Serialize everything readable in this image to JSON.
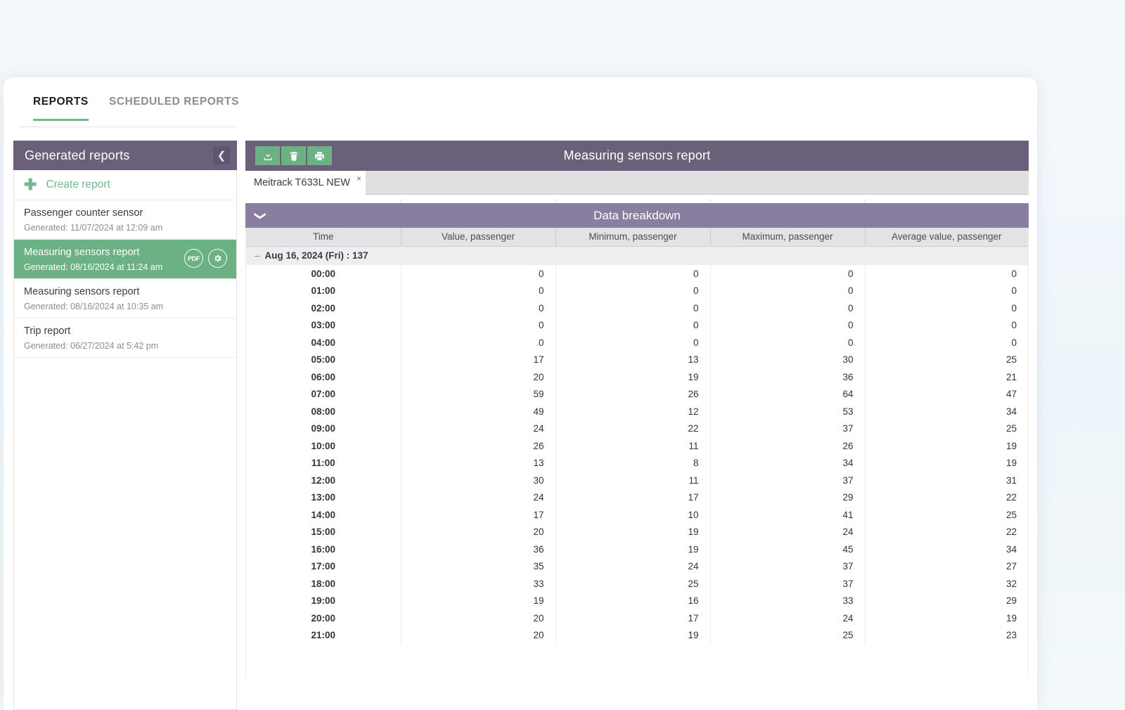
{
  "tabs": {
    "reports": "REPORTS",
    "scheduled": "SCHEDULED REPORTS"
  },
  "sidebar": {
    "title": "Generated reports",
    "collapse_icon": "chevron-left",
    "create_label": "Create report",
    "items": [
      {
        "name": "Passenger counter sensor",
        "generated": "Generated: 11/07/2024 at 12:09 am",
        "selected": false
      },
      {
        "name": "Measuring sensors report",
        "generated": "Generated: 08/16/2024 at 11:24 am",
        "selected": true,
        "pdf_label": "PDF"
      },
      {
        "name": "Measuring sensors report",
        "generated": "Generated: 08/16/2024 at 10:35 am",
        "selected": false
      },
      {
        "name": "Trip report",
        "generated": "Generated: 06/27/2024 at 5:42 pm",
        "selected": false
      }
    ]
  },
  "report": {
    "title": "Measuring sensors report",
    "toolbar": [
      {
        "name": "download-button",
        "icon": "download-icon"
      },
      {
        "name": "delete-button",
        "icon": "trash-icon"
      },
      {
        "name": "print-button",
        "icon": "printer-icon"
      }
    ],
    "device_tab": "Meitrack T633L NEW",
    "device_tab_close": "×"
  },
  "breakdown": {
    "title": "Data breakdown",
    "chevron_icon": "chevron-down",
    "columns": [
      "Time",
      "Value, passenger",
      "Minimum, passenger",
      "Maximum, passenger",
      "Average value, passenger"
    ],
    "group_row": {
      "toggle": "–",
      "label": "Aug 16, 2024 (Fri) : 137"
    },
    "rows": [
      {
        "time": "00:00",
        "value": "0",
        "min": "0",
        "max": "0",
        "avg": "0"
      },
      {
        "time": "01:00",
        "value": "0",
        "min": "0",
        "max": "0",
        "avg": "0"
      },
      {
        "time": "02:00",
        "value": "0",
        "min": "0",
        "max": "0",
        "avg": "0"
      },
      {
        "time": "03:00",
        "value": "0",
        "min": "0",
        "max": "0",
        "avg": "0"
      },
      {
        "time": "04:00",
        "value": "0",
        "min": "0",
        "max": "0",
        "avg": "0"
      },
      {
        "time": "05:00",
        "value": "17",
        "min": "13",
        "max": "30",
        "avg": "25"
      },
      {
        "time": "06:00",
        "value": "20",
        "min": "19",
        "max": "36",
        "avg": "21"
      },
      {
        "time": "07:00",
        "value": "59",
        "min": "26",
        "max": "64",
        "avg": "47"
      },
      {
        "time": "08:00",
        "value": "49",
        "min": "12",
        "max": "53",
        "avg": "34"
      },
      {
        "time": "09:00",
        "value": "24",
        "min": "22",
        "max": "37",
        "avg": "25"
      },
      {
        "time": "10:00",
        "value": "26",
        "min": "11",
        "max": "26",
        "avg": "19"
      },
      {
        "time": "11:00",
        "value": "13",
        "min": "8",
        "max": "34",
        "avg": "19"
      },
      {
        "time": "12:00",
        "value": "30",
        "min": "11",
        "max": "37",
        "avg": "31"
      },
      {
        "time": "13:00",
        "value": "24",
        "min": "17",
        "max": "29",
        "avg": "22"
      },
      {
        "time": "14:00",
        "value": "17",
        "min": "10",
        "max": "41",
        "avg": "25"
      },
      {
        "time": "15:00",
        "value": "20",
        "min": "19",
        "max": "24",
        "avg": "22"
      },
      {
        "time": "16:00",
        "value": "36",
        "min": "19",
        "max": "45",
        "avg": "34"
      },
      {
        "time": "17:00",
        "value": "35",
        "min": "24",
        "max": "37",
        "avg": "27"
      },
      {
        "time": "18:00",
        "value": "33",
        "min": "25",
        "max": "37",
        "avg": "32"
      },
      {
        "time": "19:00",
        "value": "19",
        "min": "16",
        "max": "33",
        "avg": "29"
      },
      {
        "time": "20:00",
        "value": "20",
        "min": "17",
        "max": "24",
        "avg": "19"
      },
      {
        "time": "21:00",
        "value": "20",
        "min": "19",
        "max": "25",
        "avg": "23"
      }
    ]
  },
  "colors": {
    "purple_dark": "#6b6079",
    "purple_light": "#897ea0",
    "green": "#6cb183",
    "green_accent": "#74b98c"
  }
}
